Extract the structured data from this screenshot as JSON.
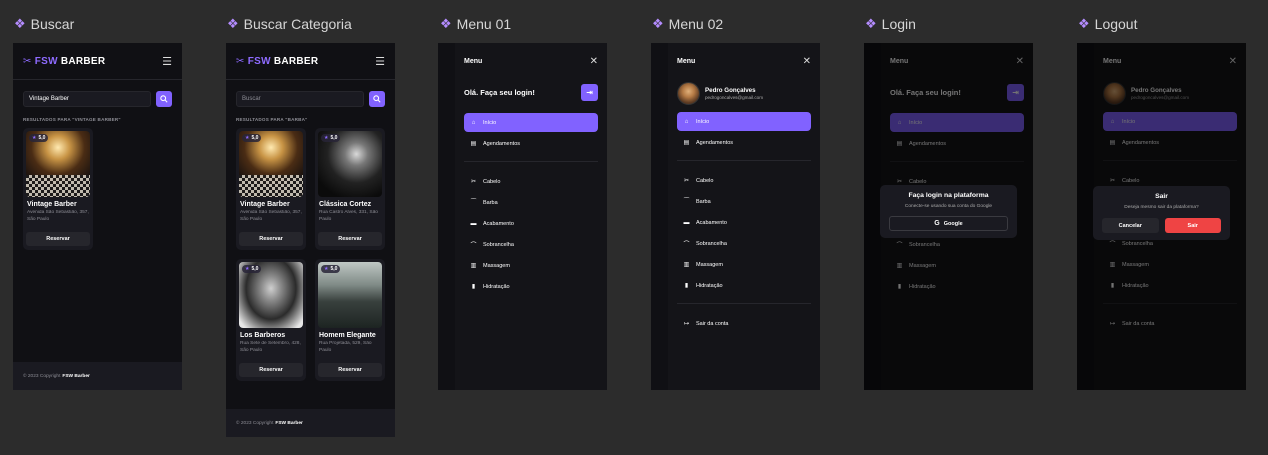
{
  "colors": {
    "accent": "#8162ff",
    "bg": "#101014",
    "card": "#1a1a21",
    "danger": "#ef4444"
  },
  "frames": {
    "buscar": "Buscar",
    "buscar_categoria": "Buscar Categoria",
    "menu01": "Menu 01",
    "menu02": "Menu 02",
    "login": "Login",
    "logout": "Logout"
  },
  "header": {
    "logo_mark": "✂",
    "logo_fsw": "FSW",
    "logo_text": "BARBER",
    "menu_icon": "hamburger-icon"
  },
  "search1": {
    "value": "Vintage Barber",
    "results_title": "RESULTADOS PARA \"VINTAGE BARBER\""
  },
  "search2": {
    "placeholder": "Buscar",
    "results_title": "RESULTADOS PARA \"BARBA\""
  },
  "shops": [
    {
      "name": "Vintage Barber",
      "address": "Avenida São Sebastião, 357, São Paulo",
      "rating": "5,0"
    },
    {
      "name": "Clássica Cortez",
      "address": "Rua Castro Alves, 331, São Paulo",
      "rating": "5,0"
    },
    {
      "name": "Los Barberos",
      "address": "Rua Sete de Setembro, 428, São Paulo",
      "rating": "5,0"
    },
    {
      "name": "Homem Elegante",
      "address": "Rua Projetada, 529, São Paulo",
      "rating": "5,0"
    }
  ],
  "book_label": "Reservar",
  "footer": {
    "copy": "© 2023 Copyright",
    "brand": "FSW Barber"
  },
  "menu": {
    "title": "Menu",
    "login_prompt": "Olá. Faça seu login!",
    "user_name": "Pedro Gonçalves",
    "user_email": "pedrogoncalves@gmail.com",
    "nav": [
      "Início",
      "Agendamentos"
    ],
    "categories": [
      "Cabelo",
      "Barba",
      "Acabamento",
      "Sobrancelha",
      "Massagem",
      "Hidratação"
    ],
    "logout": "Sair da conta"
  },
  "login_dialog": {
    "title": "Faça login na plataforma",
    "subtitle": "Conecte-se usando sua conta do Google",
    "button": "Google"
  },
  "logout_dialog": {
    "title": "Sair",
    "subtitle": "Deseja mesmo sair da plataforma?",
    "cancel": "Cancelar",
    "confirm": "Sair"
  }
}
